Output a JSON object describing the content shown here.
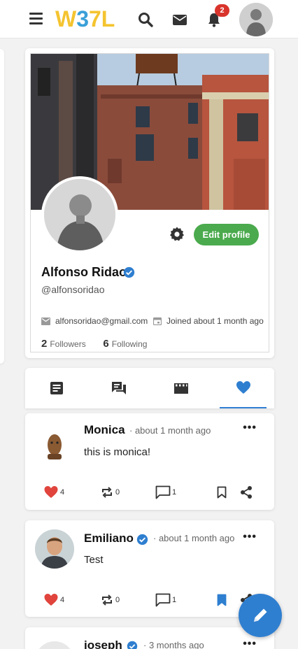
{
  "header": {
    "logo": {
      "w": "W",
      "three": "3",
      "seven_l": "7L"
    },
    "notification_count": "2",
    "icons": [
      "menu-icon",
      "search-icon",
      "envelope-icon",
      "bell-icon"
    ]
  },
  "profile": {
    "name": "Alfonso Ridao",
    "handle": "@alfonsoridao",
    "email": "alfonsoridao@gmail.com",
    "joined": "Joined about 1 month ago",
    "followers_count": "2",
    "followers_label": "Followers",
    "following_count": "6",
    "following_label": "Following",
    "edit_label": "Edit profile"
  },
  "tabs": [
    {
      "icon": "article-icon",
      "active": false
    },
    {
      "icon": "comments-icon",
      "active": false
    },
    {
      "icon": "video-icon",
      "active": false
    },
    {
      "icon": "heart-icon",
      "active": true
    }
  ],
  "posts": [
    {
      "author": "Monica",
      "verified": false,
      "time": "about 1 month ago",
      "text": "this is monica!",
      "likes": "4",
      "reposts": "0",
      "comments": "1",
      "bookmarked": false
    },
    {
      "author": "Emiliano",
      "verified": true,
      "time": "about 1 month ago",
      "text": "Test",
      "likes": "4",
      "reposts": "0",
      "comments": "1",
      "bookmarked": true
    },
    {
      "author": "joseph",
      "verified": true,
      "time": "3 months ago"
    }
  ],
  "colors": {
    "accent": "#2f7fd0",
    "edit_button": "#4aaa4d",
    "like": "#e0443c",
    "badge": "#d9342b",
    "logo_yellow": "#f4c430",
    "logo_blue": "#3aa0d8"
  }
}
